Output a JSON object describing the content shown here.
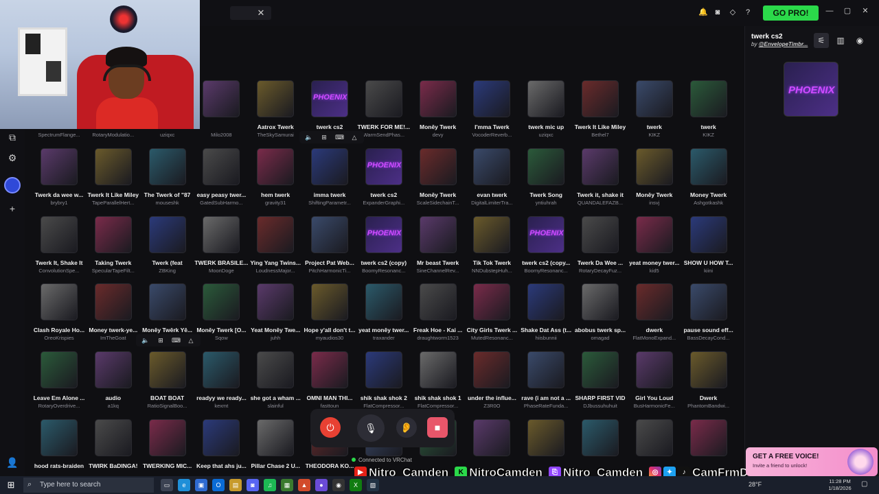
{
  "topbar": {
    "close_glyph": "✕",
    "icons": [
      "bell-icon",
      "discord-icon",
      "diamond-icon",
      "help-icon"
    ],
    "icon_glyphs": [
      "🔔",
      "◙",
      "◇",
      "?"
    ],
    "go_pro_label": "GO PRO!",
    "window_controls": [
      "—",
      "▢",
      "✕"
    ]
  },
  "left_rail": {
    "icons": [
      "puzzle-icon",
      "gear-icon",
      "active-app-icon",
      "add-icon",
      "user-icon"
    ],
    "glyphs": [
      "⧉",
      "⚙",
      "",
      "+",
      "👤"
    ]
  },
  "grid": {
    "rows": [
      [
        {
          "name": "",
          "author": "SpectrumFlange..."
        },
        {
          "name": "",
          "author": "RotaryModulatio..."
        },
        {
          "name": "",
          "author": "uziqxc"
        },
        {
          "name": "",
          "author": "Milo2008"
        },
        {
          "name": "Aatrox Twerk",
          "author": "TheSkySamurai"
        },
        {
          "name": "twerk cs2",
          "author": ""
        },
        {
          "name": "TWERK FOR ME!...",
          "author": "WarmSendPhas..."
        },
        {
          "name": "Monēy Twerk",
          "author": "devy"
        },
        {
          "name": "I'mma Twerk",
          "author": "VocoderReverb..."
        },
        {
          "name": "twerk mic up",
          "author": "uziqxc"
        },
        {
          "name": "Twerk It Like Miley",
          "author": "Bethel7"
        },
        {
          "name": "twerk",
          "author": "KIKZ"
        },
        {
          "name": "twerk",
          "author": "KIKZ"
        }
      ],
      [
        {
          "name": "Twerk da wee w...",
          "author": "brybry1"
        },
        {
          "name": "Twerk It Like Miley",
          "author": "TapeParallelHert..."
        },
        {
          "name": "The Twerk of \"87",
          "author": "mouseshk"
        },
        {
          "name": "easy peasy twer...",
          "author": "GatedSubHarmo..."
        },
        {
          "name": "hem twerk",
          "author": "gravity31"
        },
        {
          "name": "imma twerk",
          "author": "ShiftingParametr..."
        },
        {
          "name": "twerk cs2",
          "author": "ExpanderGraphi..."
        },
        {
          "name": "Monēy Twerk",
          "author": "ScaleSidechainT..."
        },
        {
          "name": "evan twerk",
          "author": "DigitalLimiterTra..."
        },
        {
          "name": "Twerk Song",
          "author": "yntiuhrah"
        },
        {
          "name": "Twerk it, shake it",
          "author": "QUANDALEFAZB..."
        },
        {
          "name": "Monēy Twerk",
          "author": "insvj"
        },
        {
          "name": "Money Twerk",
          "author": "Ashgotkashk"
        }
      ],
      [
        {
          "name": "Twerk It, Shake It",
          "author": "ConvolutionSpe..."
        },
        {
          "name": "Taking Twerk",
          "author": "SpecularTapeFilt..."
        },
        {
          "name": "Twerk (feat",
          "author": "ZBKing"
        },
        {
          "name": "TWERK BRASILE...",
          "author": "MoonDoge"
        },
        {
          "name": "Ying Yang Twins...",
          "author": "LoudnessMajor..."
        },
        {
          "name": "Project Pat Web...",
          "author": "PitchHarmonicTi..."
        },
        {
          "name": "twerk cs2 (copy)",
          "author": "BoomyResonanc..."
        },
        {
          "name": "Mr beast Twerk",
          "author": "SineChannelRev..."
        },
        {
          "name": "Tik Tok Twerk",
          "author": "NNDubstepHuh..."
        },
        {
          "name": "twerk cs2 (copy...",
          "author": "BoomyResonanc..."
        },
        {
          "name": "Twerk Da Wee ...",
          "author": "RotaryDecayFuz..."
        },
        {
          "name": "yeat money twer...",
          "author": "kid5"
        },
        {
          "name": "SHOW U HOW T...",
          "author": "kiini"
        }
      ],
      [
        {
          "name": "Clash Royale Ho...",
          "author": "OreoKrispies"
        },
        {
          "name": "Money twerk-ye...",
          "author": "ImTheGoat"
        },
        {
          "name": "Monēy Twērk Yē...",
          "author": ""
        },
        {
          "name": "Monēy Twerk [O...",
          "author": "Sqow"
        },
        {
          "name": "Yeat Monēy Twe...",
          "author": "juhh"
        },
        {
          "name": "Hope y'all don't t...",
          "author": "myaudios30"
        },
        {
          "name": "yeat monēy twer...",
          "author": "traxander"
        },
        {
          "name": "Freak Hoe - Kai ...",
          "author": "draughtworm1523"
        },
        {
          "name": "City Girls Twerk ...",
          "author": "MutedResonanc..."
        },
        {
          "name": "Shake Dat Ass (t...",
          "author": "hiisbunnii"
        },
        {
          "name": "abobus twerk sp...",
          "author": "omagad"
        },
        {
          "name": "dwerk",
          "author": "FlatMonoExpand..."
        },
        {
          "name": "pause sound eff...",
          "author": "BassDecayCond..."
        }
      ],
      [
        {
          "name": "Leave Em Alone ...",
          "author": "RotaryOverdrive..."
        },
        {
          "name": "audio",
          "author": "a1kq"
        },
        {
          "name": "BOAT BOAT",
          "author": "RatioSignalBoo..."
        },
        {
          "name": "readyy we ready...",
          "author": "kexmt"
        },
        {
          "name": "she got a wham ...",
          "author": "slainful"
        },
        {
          "name": "OMNI MAN THI...",
          "author": "fasttoun"
        },
        {
          "name": "shik shak shok 2",
          "author": "FlatCompressor..."
        },
        {
          "name": "shik shak shok 1",
          "author": "FlatCompressor..."
        },
        {
          "name": "under the influe...",
          "author": "Z3R0O"
        },
        {
          "name": "rave (i am not a ...",
          "author": "PhaseRateFunda..."
        },
        {
          "name": "SHARP FIRST VID",
          "author": "DJbussuhuhuit"
        },
        {
          "name": "Girl You Loud",
          "author": "BusHarmonicFe..."
        },
        {
          "name": "Dwerk",
          "author": "PhantomBandwi..."
        }
      ],
      [
        {
          "name": "hood rats-braiden",
          "author": ""
        },
        {
          "name": "TWIRK BaDINGA!",
          "author": ""
        },
        {
          "name": "TWERKING MIC...",
          "author": ""
        },
        {
          "name": "Keep that ahs ju...",
          "author": ""
        },
        {
          "name": "Pillar Chase 2 U...",
          "author": ""
        },
        {
          "name": "THEODORA KO...",
          "author": ""
        },
        {
          "name": "",
          "author": ""
        },
        {
          "name": "",
          "author": ""
        },
        {
          "name": "",
          "author": ""
        },
        {
          "name": "",
          "author": ""
        },
        {
          "name": "",
          "author": ""
        },
        {
          "name": "",
          "author": ""
        },
        {
          "name": "",
          "author": ""
        }
      ]
    ]
  },
  "right_panel": {
    "title": "twerk cs2",
    "by": "by",
    "author": "@EnvelopeTimbr...",
    "icon_glyphs": [
      "⚟",
      "▥",
      "◉"
    ]
  },
  "control_bar": {
    "status_text": "Connected to VRChat",
    "glyphs": [
      "⏻",
      "🎙",
      "👂",
      "■"
    ]
  },
  "social_overlay": {
    "youtube": "Nitro_Camden",
    "kick": "NitroCamden",
    "twitch": "Nitro_Camden",
    "other": "CamFrmDaLou"
  },
  "promo": {
    "title": "GET A FREE VOICE!",
    "subtitle": "Invite a friend to unlock!"
  },
  "taskbar": {
    "search_placeholder": "Type here to search",
    "weather": "28°F",
    "time": "11:28 PM",
    "date": "1/18/2026"
  }
}
